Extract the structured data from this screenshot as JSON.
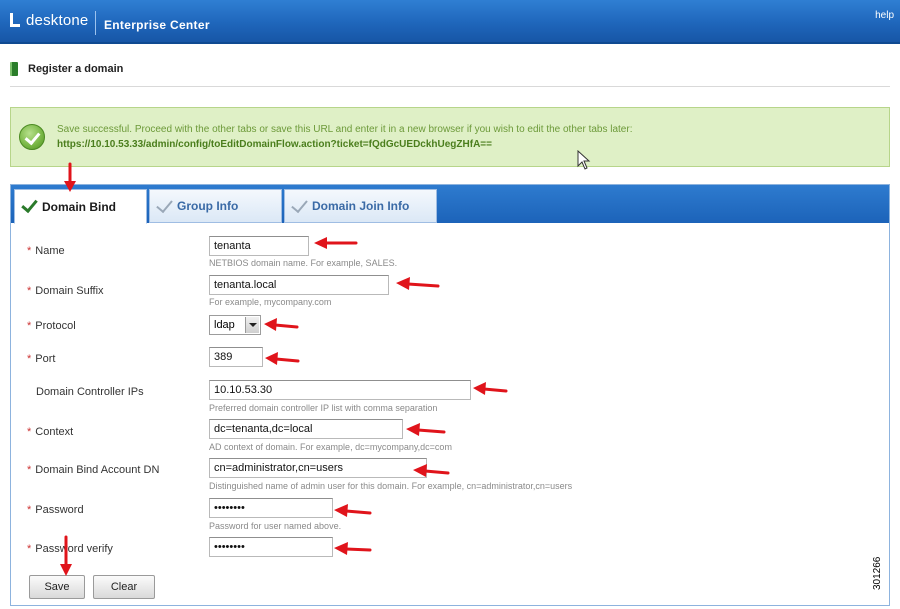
{
  "header": {
    "logo_text": "desktone",
    "app_title": "Enterprise Center",
    "help_label": "help"
  },
  "page": {
    "title": "Register a domain"
  },
  "success": {
    "message": "Save successful. Proceed with the other tabs or save this URL and enter it in a new browser if you wish to edit the other tabs later:",
    "url": "https://10.10.53.33/admin/config/toEditDomainFlow.action?ticket=fQdGcUEDckhUegZHfA=="
  },
  "tabs": [
    {
      "label": "Domain Bind",
      "active": true
    },
    {
      "label": "Group Info",
      "active": false
    },
    {
      "label": "Domain Join Info",
      "active": false
    }
  ],
  "form": {
    "name": {
      "label": "Name",
      "value": "tenanta",
      "hint": "NETBIOS domain name. For example, SALES."
    },
    "domain_suffix": {
      "label": "Domain Suffix",
      "value": "tenanta.local",
      "hint": "For example, mycompany.com"
    },
    "protocol": {
      "label": "Protocol",
      "value": "ldap"
    },
    "port": {
      "label": "Port",
      "value": "389"
    },
    "dc_ips": {
      "label": "Domain Controller IPs",
      "value": "10.10.53.30",
      "hint": "Preferred domain controller IP list with comma separation"
    },
    "context": {
      "label": "Context",
      "value": "dc=tenanta,dc=local",
      "hint": "AD context of domain. For example, dc=mycompany,dc=com"
    },
    "bind_dn": {
      "label": "Domain Bind Account DN",
      "value": "cn=administrator,cn=users",
      "hint": "Distinguished name of admin user for this domain. For example, cn=administrator,cn=users"
    },
    "password": {
      "label": "Password",
      "value": "••••••••",
      "hint": "Password for user named above."
    },
    "password_verify": {
      "label": "Password verify",
      "value": "••••••••"
    },
    "required_mark": "*"
  },
  "buttons": {
    "save": "Save",
    "clear": "Clear"
  },
  "figure_number": "301266",
  "colors": {
    "header_blue": "#1f66bb",
    "success_bg": "#dff0c6",
    "annotation_red": "#e0141b"
  }
}
